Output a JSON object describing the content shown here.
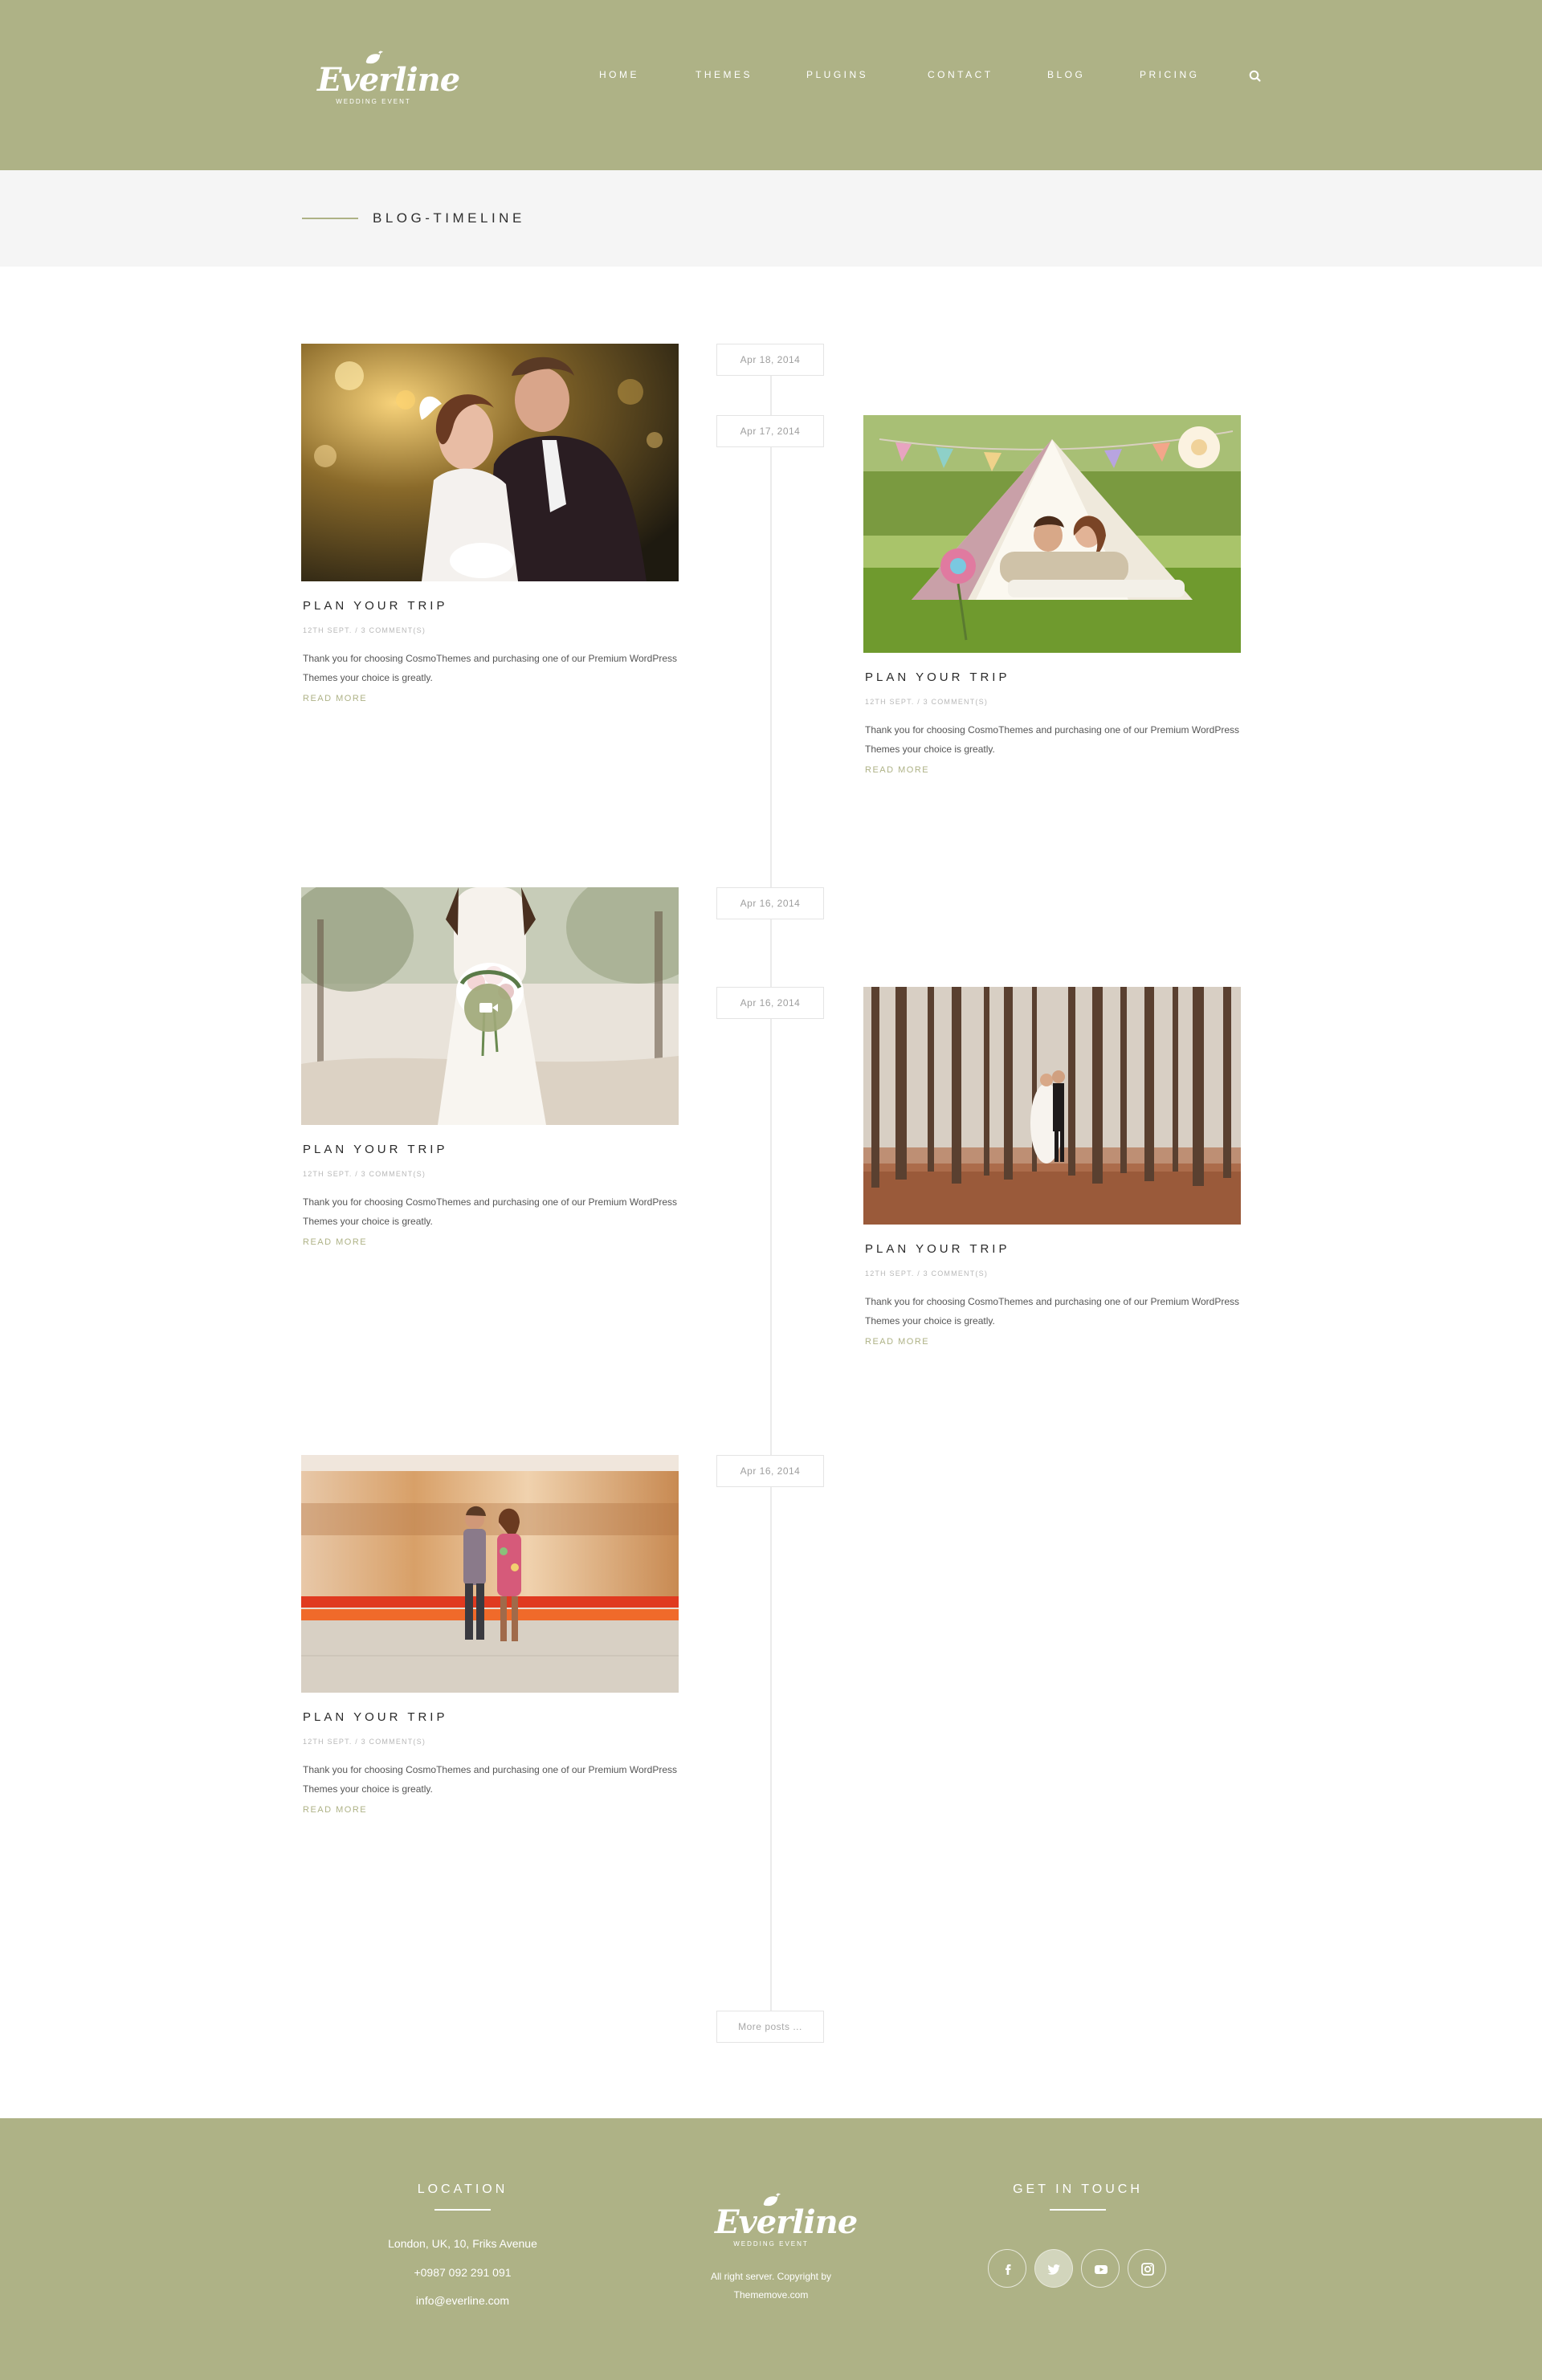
{
  "brand": {
    "name": "Everline",
    "tagline": "WEDDING EVENT"
  },
  "nav": {
    "items": [
      {
        "label": "HOME"
      },
      {
        "label": "THEMES"
      },
      {
        "label": "PLUGINS"
      },
      {
        "label": "CONTACT"
      },
      {
        "label": "BLOG"
      },
      {
        "label": "PRICING"
      }
    ],
    "search_icon": "search-icon"
  },
  "page": {
    "title": "BLOG-TIMELINE"
  },
  "timeline": {
    "dates": [
      "Apr 18, 2014",
      "Apr 17, 2014",
      "Apr 16, 2014",
      "Apr 16, 2014",
      "Apr 16, 2014"
    ],
    "posts": [
      {
        "title": "PLAN YOUR TRIP",
        "meta": "12TH SEPT. / 3 COMMENT(S)",
        "excerpt": "Thank you for choosing CosmoThemes and purchasing one of our Premium WordPress Themes your choice is greatly.",
        "read_more": "READ MORE",
        "photo": "bride-and-groom-bokeh"
      },
      {
        "title": "PLAN YOUR TRIP",
        "meta": "12TH SEPT. / 3 COMMENT(S)",
        "excerpt": "Thank you for choosing CosmoThemes and purchasing one of our Premium WordPress Themes your choice is greatly.",
        "read_more": "READ MORE",
        "photo": "couple-in-tent"
      },
      {
        "title": "PLAN YOUR TRIP",
        "meta": "12TH SEPT. / 3 COMMENT(S)",
        "excerpt": "Thank you for choosing CosmoThemes and purchasing one of our Premium WordPress Themes your choice is greatly.",
        "read_more": "READ MORE",
        "photo": "bride-with-bouquet",
        "video_icon": "video-camera-icon"
      },
      {
        "title": "PLAN YOUR TRIP",
        "meta": "12TH SEPT. / 3 COMMENT(S)",
        "excerpt": "Thank you for choosing CosmoThemes and purchasing one of our Premium WordPress Themes your choice is greatly.",
        "read_more": "READ MORE",
        "photo": "couple-in-forest"
      },
      {
        "title": "PLAN YOUR TRIP",
        "meta": "12TH SEPT. / 3 COMMENT(S)",
        "excerpt": "Thank you for choosing CosmoThemes and purchasing one of our Premium WordPress Themes your choice is greatly.",
        "read_more": "READ MORE",
        "photo": "couple-at-train-platform"
      }
    ],
    "more_posts": "More posts ..."
  },
  "footer": {
    "location": {
      "title": "LOCATION",
      "address": "London, UK, 10, Friks Avenue",
      "phone": "+0987 092 291 091",
      "email": "info@everline.com"
    },
    "copyright": {
      "line1": "All right server. Copyright by",
      "line2": "Thememove.com"
    },
    "contact": {
      "title": "GET IN TOUCH",
      "social": [
        "facebook-icon",
        "twitter-icon",
        "youtube-icon",
        "instagram-icon"
      ]
    }
  },
  "colors": {
    "brand_green": "#aeb286",
    "title_bar": "#f5f5f5",
    "text_dark": "#2a2a2a",
    "text_muted": "#b8b8b8"
  }
}
